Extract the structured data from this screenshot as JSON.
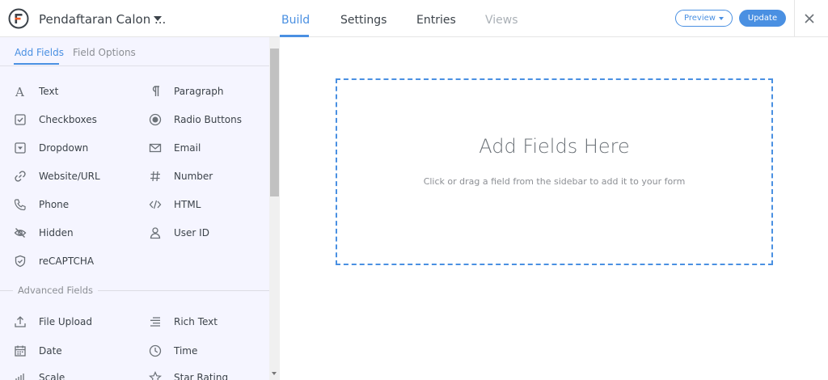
{
  "header": {
    "form_title": "Pendaftaran Calon ...",
    "tabs": [
      {
        "label": "Build",
        "state": "active"
      },
      {
        "label": "Settings",
        "state": "normal"
      },
      {
        "label": "Entries",
        "state": "normal"
      },
      {
        "label": "Views",
        "state": "disabled"
      }
    ],
    "preview_label": "Preview",
    "update_label": "Update"
  },
  "sidebar": {
    "sub_tabs": [
      {
        "label": "Add Fields",
        "state": "active"
      },
      {
        "label": "Field Options",
        "state": "inactive"
      }
    ],
    "fields": [
      {
        "label": "Text",
        "icon": "text-icon"
      },
      {
        "label": "Paragraph",
        "icon": "paragraph-icon"
      },
      {
        "label": "Checkboxes",
        "icon": "checkbox-icon"
      },
      {
        "label": "Radio Buttons",
        "icon": "radio-icon"
      },
      {
        "label": "Dropdown",
        "icon": "dropdown-icon"
      },
      {
        "label": "Email",
        "icon": "envelope-icon"
      },
      {
        "label": "Website/URL",
        "icon": "link-icon"
      },
      {
        "label": "Number",
        "icon": "hash-icon"
      },
      {
        "label": "Phone",
        "icon": "phone-icon"
      },
      {
        "label": "HTML",
        "icon": "code-icon"
      },
      {
        "label": "Hidden",
        "icon": "eye-off-icon"
      },
      {
        "label": "User ID",
        "icon": "user-icon"
      },
      {
        "label": "reCAPTCHA",
        "icon": "shield-icon"
      }
    ],
    "advanced_label": "Advanced Fields",
    "advanced_fields": [
      {
        "label": "File Upload",
        "icon": "upload-icon"
      },
      {
        "label": "Rich Text",
        "icon": "align-icon"
      },
      {
        "label": "Date",
        "icon": "calendar-icon"
      },
      {
        "label": "Time",
        "icon": "clock-icon"
      },
      {
        "label": "Scale",
        "icon": "scale-icon"
      },
      {
        "label": "Star Rating",
        "icon": "star-icon"
      }
    ]
  },
  "canvas": {
    "title": "Add Fields Here",
    "subtitle": "Click or drag a field from the sidebar to add it to your form"
  },
  "colors": {
    "accent": "#4a90e2",
    "sidebar_bg": "#f5f5ff",
    "text": "#3c434a"
  }
}
